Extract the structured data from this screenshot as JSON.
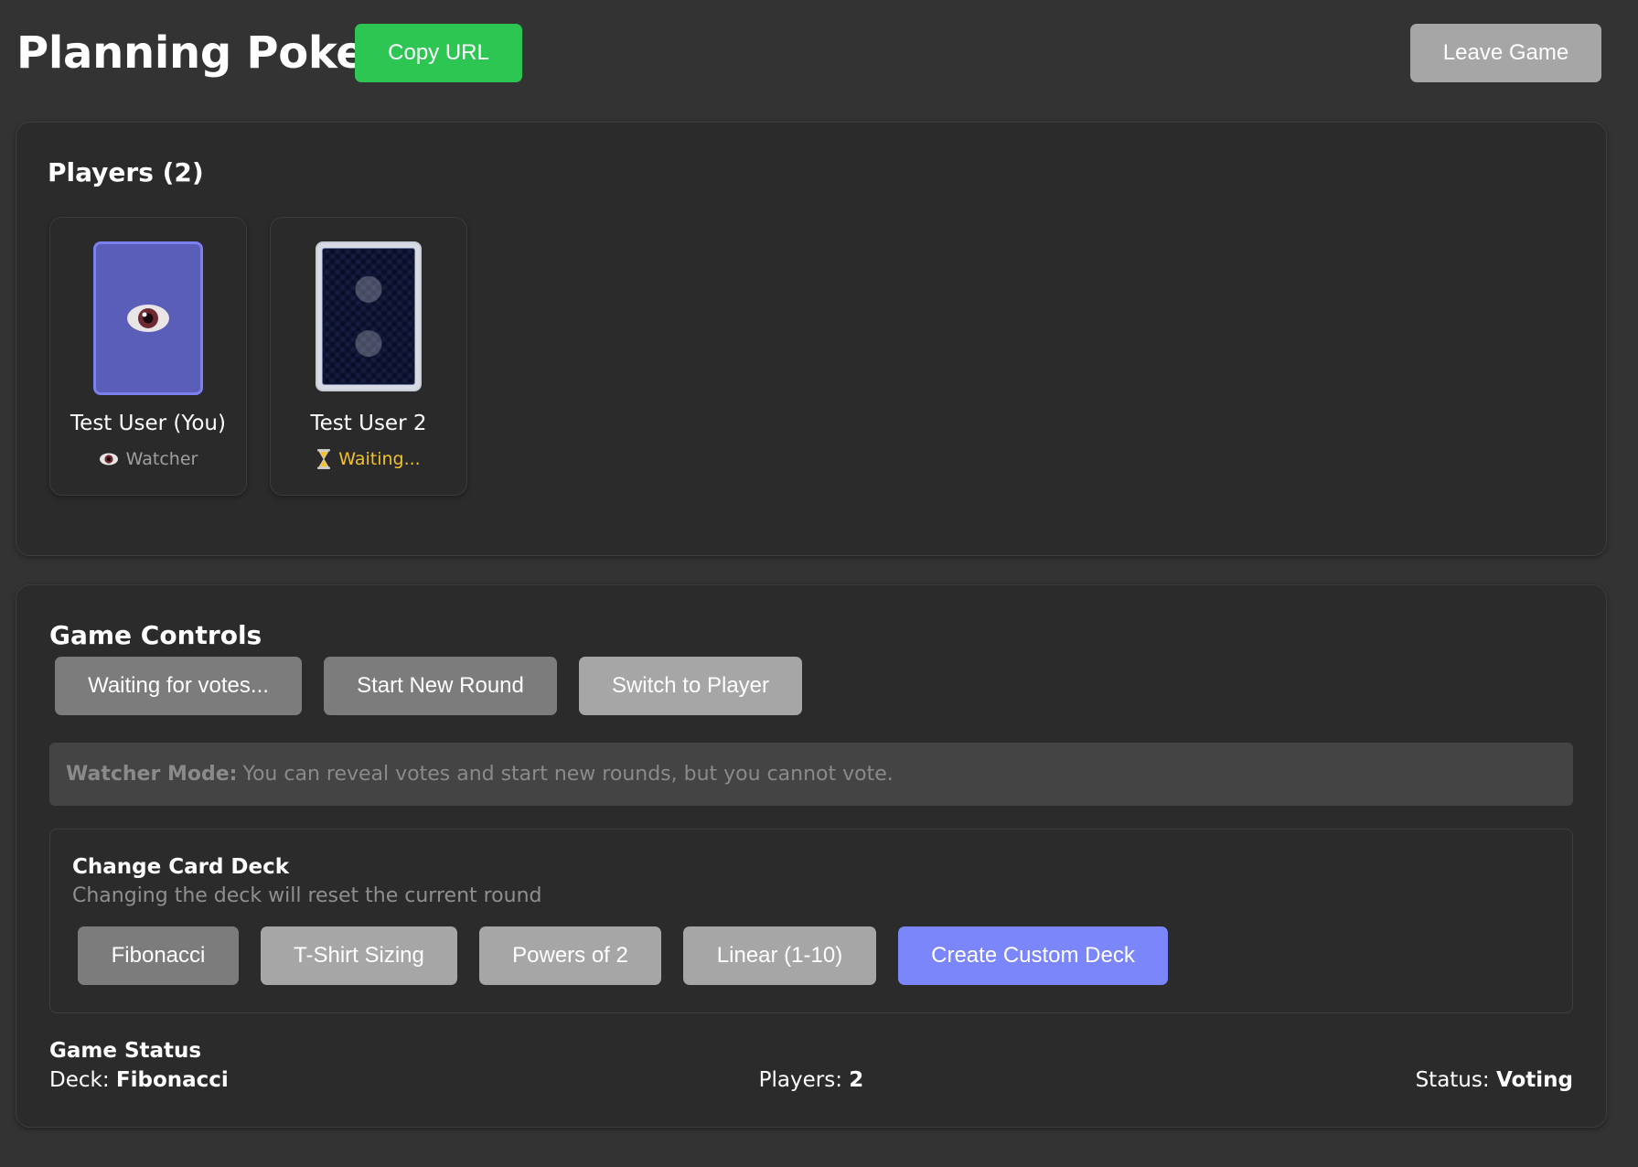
{
  "header": {
    "title": "Planning Poker",
    "copy_label": "Copy URL",
    "leave_label": "Leave Game"
  },
  "players": {
    "title": "Players (2)",
    "list": [
      {
        "name": "Test User (You)",
        "status": "Watcher",
        "status_icon": "eye-icon",
        "card": "watcher-card"
      },
      {
        "name": "Test User 2",
        "status": "Waiting...",
        "status_icon": "hourglass-icon",
        "card": "card-back"
      }
    ]
  },
  "controls": {
    "title": "Game Controls",
    "buttons": {
      "waiting": "Waiting for votes...",
      "new_round": "Start New Round",
      "switch": "Switch to Player"
    },
    "watcher_note": {
      "label": "Watcher Mode:",
      "text": "You can reveal votes and start new rounds, but you cannot vote."
    },
    "deck": {
      "title": "Change Card Deck",
      "subtitle": "Changing the deck will reset the current round",
      "options": [
        "Fibonacci",
        "T-Shirt Sizing",
        "Powers of 2",
        "Linear (1-10)"
      ],
      "custom_label": "Create Custom Deck",
      "selected": "Fibonacci"
    }
  },
  "status": {
    "title": "Game Status",
    "deck_label": "Deck:",
    "deck_value": "Fibonacci",
    "players_label": "Players:",
    "players_value": "2",
    "status_label": "Status:",
    "status_value": "Voting"
  },
  "colors": {
    "background": "#333333",
    "panel": "#2b2b2b",
    "copy_button": "#2dc653",
    "custom_deck_button": "#7b86fb",
    "waiting_text": "#f2c12e",
    "watcher_card": "#5b5eb8"
  }
}
